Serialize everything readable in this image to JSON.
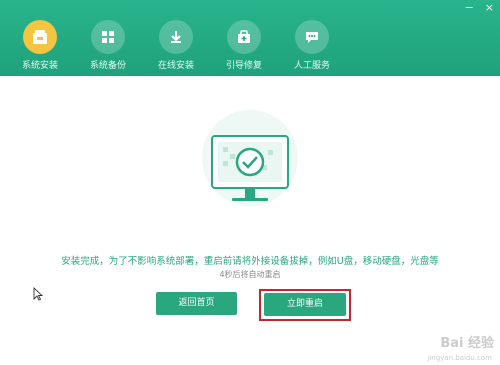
{
  "window": {
    "controls": {
      "minimize": "−",
      "close": "×"
    }
  },
  "nav": {
    "items": [
      {
        "label": "系统安装",
        "icon": "system-install-icon",
        "active": true
      },
      {
        "label": "系统备份",
        "icon": "system-backup-icon",
        "active": false
      },
      {
        "label": "在线安装",
        "icon": "online-install-icon",
        "active": false
      },
      {
        "label": "引导修复",
        "icon": "boot-repair-icon",
        "active": false
      },
      {
        "label": "人工服务",
        "icon": "manual-service-icon",
        "active": false
      }
    ]
  },
  "main": {
    "message": "安装完成，为了不影响系统部署，重启前请将外接设备拔掉，例如U盘，移动硬盘，光盘等",
    "countdown": "4秒后将自动重启",
    "buttons": {
      "home": "返回首页",
      "restart": "立即重启"
    }
  },
  "watermark": {
    "text": "Bai 经验",
    "sub": "jingyan.baidu.com"
  },
  "colors": {
    "header": "#21a67e",
    "accent": "#2aa77f",
    "active_icon": "#f5c542",
    "highlight_border": "#c0282d"
  }
}
